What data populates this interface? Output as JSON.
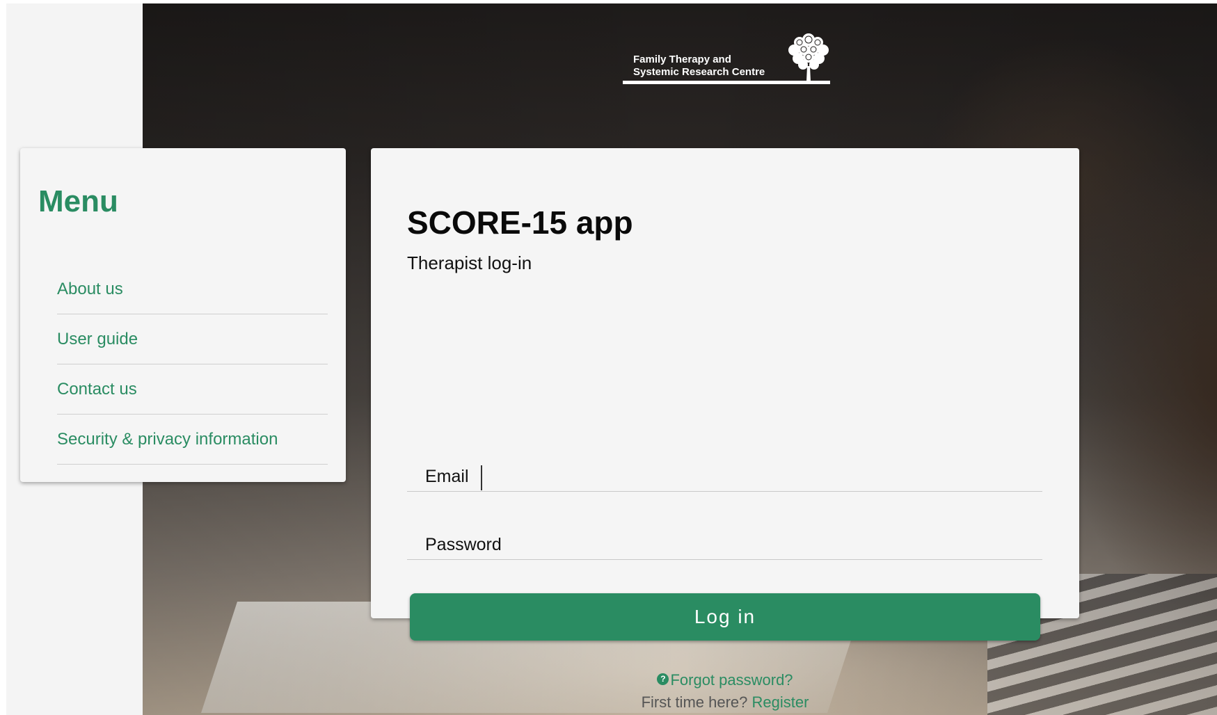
{
  "logo": {
    "line1": "Family Therapy and",
    "line2": "Systemic Research Centre"
  },
  "menu": {
    "title": "Menu",
    "items": [
      {
        "label": "About us"
      },
      {
        "label": "User guide"
      },
      {
        "label": "Contact us"
      },
      {
        "label": "Security & privacy information"
      }
    ]
  },
  "login": {
    "title": "SCORE-15 app",
    "subtitle": "Therapist log-in",
    "email_label": "Email",
    "email_value": "",
    "password_label": "Password",
    "password_value": "",
    "button_label": "Log in",
    "forgot_label": "Forgot password?",
    "first_time_text": "First time here?",
    "register_label": "Register"
  },
  "colors": {
    "accent": "#2a8c62",
    "background": "#f4f4f4",
    "card": "#f5f5f5"
  },
  "icons": {
    "help": "question-circle-icon",
    "logo_tree": "tree-icon"
  }
}
